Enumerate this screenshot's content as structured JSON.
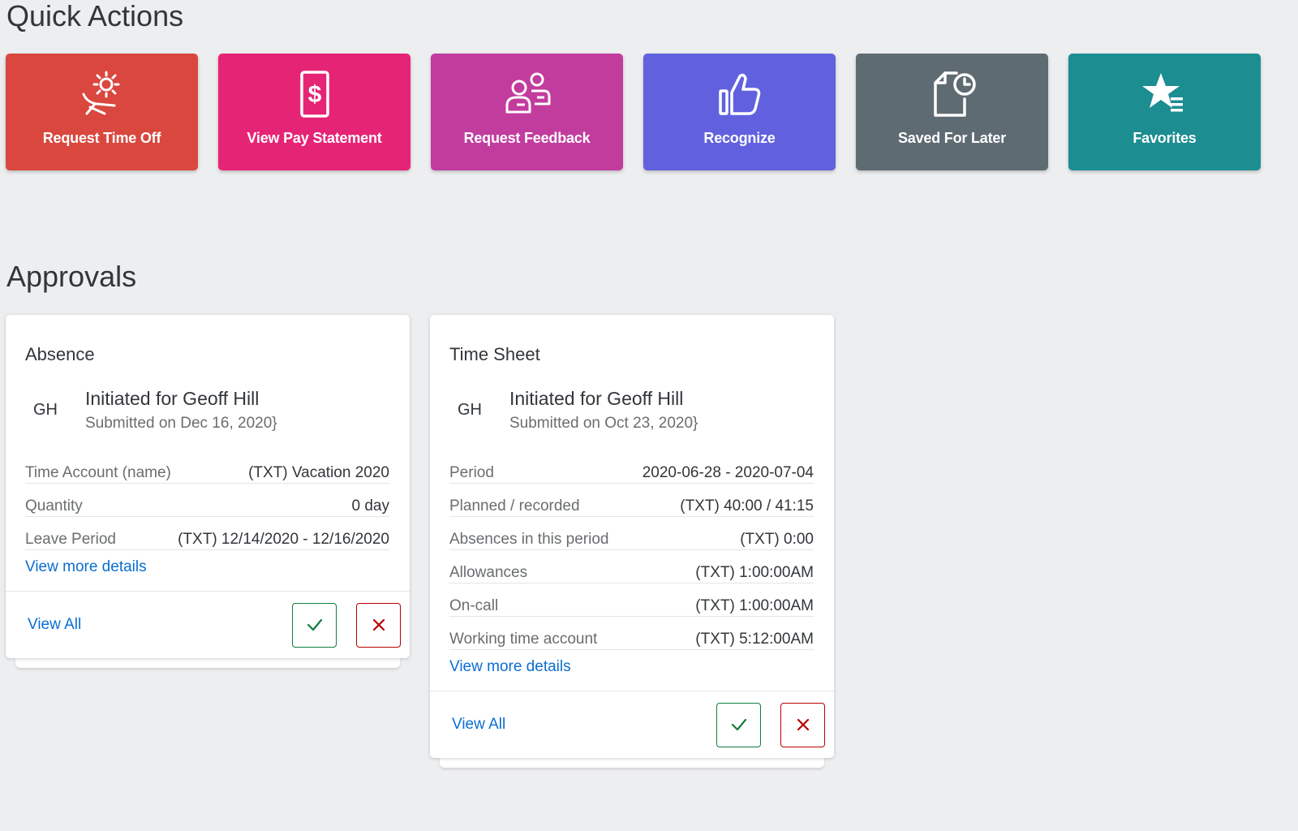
{
  "quick_actions": {
    "title": "Quick Actions",
    "tiles": [
      {
        "label": "Request Time Off",
        "icon": "sunbed-icon",
        "color": "#d9473f"
      },
      {
        "label": "View Pay Statement",
        "icon": "pay-statement-icon",
        "color": "#e62475"
      },
      {
        "label": "Request Feedback",
        "icon": "feedback-people-icon",
        "color": "#c23c9e"
      },
      {
        "label": "Recognize",
        "icon": "thumbs-up-icon",
        "color": "#6161e0"
      },
      {
        "label": "Saved For Later",
        "icon": "saved-document-clock-icon",
        "color": "#5f6b73"
      },
      {
        "label": "Favorites",
        "icon": "star-list-icon",
        "color": "#1c8d91"
      }
    ]
  },
  "approvals": {
    "title": "Approvals",
    "cards": [
      {
        "title": "Absence",
        "initials": "GH",
        "person": "Initiated for Geoff Hill",
        "submitted": "Submitted on Dec 16, 2020}",
        "fields": [
          {
            "label": "Time Account (name)",
            "value": "(TXT) Vacation 2020"
          },
          {
            "label": "Quantity",
            "value": "0 day"
          },
          {
            "label": "Leave Period",
            "value": "(TXT) 12/14/2020 - 12/16/2020"
          }
        ],
        "more_link": "View more details",
        "view_all": "View All"
      },
      {
        "title": "Time Sheet",
        "initials": "GH",
        "person": "Initiated for Geoff Hill",
        "submitted": "Submitted on Oct 23, 2020}",
        "fields": [
          {
            "label": "Period",
            "value": "2020-06-28 - 2020-07-04"
          },
          {
            "label": "Planned / recorded",
            "value": "(TXT) 40:00 / 41:15"
          },
          {
            "label": "Absences in this period",
            "value": "(TXT) 0:00"
          },
          {
            "label": "Allowances",
            "value": "(TXT) 1:00:00AM"
          },
          {
            "label": "On-call",
            "value": "(TXT) 1:00:00AM"
          },
          {
            "label": "Working time account",
            "value": "(TXT) 5:12:00AM"
          }
        ],
        "more_link": "View more details",
        "view_all": "View All"
      }
    ],
    "approve_icon": "checkmark-icon",
    "reject_icon": "close-icon",
    "approve_color": "#107e3e",
    "reject_color": "#bb0000"
  }
}
